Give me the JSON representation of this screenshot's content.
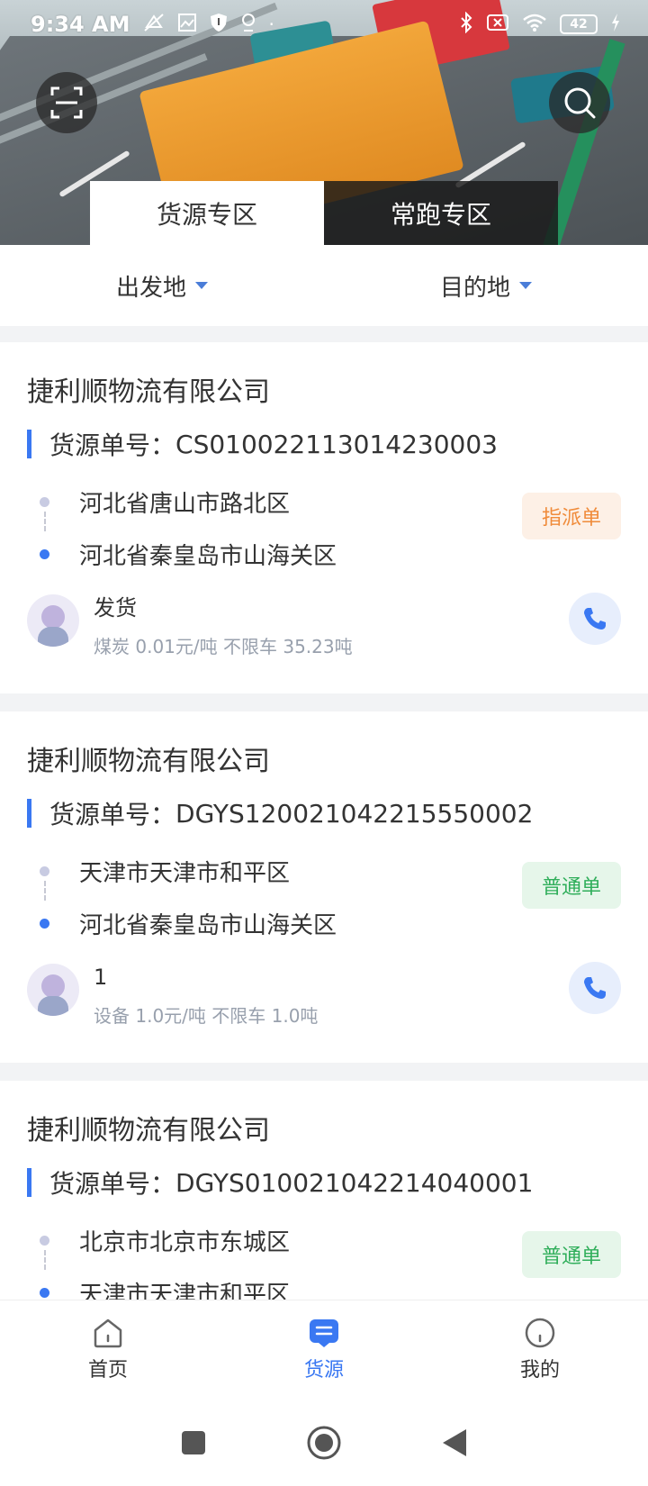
{
  "status_bar": {
    "time": "9:34 AM",
    "battery": "42"
  },
  "header": {
    "scan_icon": "scan-icon",
    "search_icon": "search-icon",
    "tabs": [
      {
        "label": "货源专区",
        "active": true
      },
      {
        "label": "常跑专区",
        "active": false
      }
    ]
  },
  "filters": {
    "origin": "出发地",
    "destination": "目的地"
  },
  "cards": [
    {
      "company": "捷利顺物流有限公司",
      "order_label": "货源单号：",
      "order_no": "CS010022113014230003",
      "from": "河北省唐山市路北区",
      "to": "河北省秦皇岛市山海关区",
      "badge": "指派单",
      "badge_type": "assign",
      "person": "发货",
      "detail": "煤炭 0.01元/吨 不限车 35.23吨"
    },
    {
      "company": "捷利顺物流有限公司",
      "order_label": "货源单号：",
      "order_no": "DGYS120021042215550002",
      "from": "天津市天津市和平区",
      "to": "河北省秦皇岛市山海关区",
      "badge": "普通单",
      "badge_type": "normal",
      "person": "1",
      "detail": "设备 1.0元/吨 不限车 1.0吨"
    },
    {
      "company": "捷利顺物流有限公司",
      "order_label": "货源单号：",
      "order_no": "DGYS010021042214040001",
      "from": "北京市北京市东城区",
      "to": "天津市天津市和平区",
      "badge": "普通单",
      "badge_type": "normal",
      "person": "",
      "detail": ""
    }
  ],
  "bottom_nav": [
    {
      "label": "首页",
      "icon": "home-icon",
      "active": false
    },
    {
      "label": "货源",
      "icon": "cargo-icon",
      "active": true
    },
    {
      "label": "我的",
      "icon": "profile-icon",
      "active": false
    }
  ],
  "colors": {
    "accent": "#3a78f2",
    "assign_badge": "#f08b3a",
    "normal_badge": "#2fae5a"
  }
}
